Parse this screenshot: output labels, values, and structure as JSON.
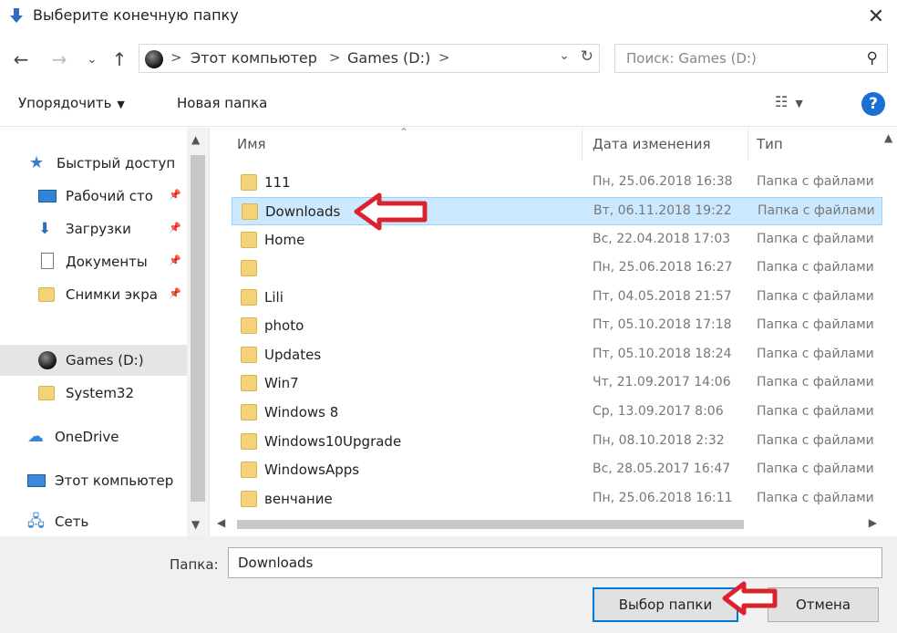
{
  "window": {
    "title": "Выберите конечную папку",
    "close_label": "✕"
  },
  "address": {
    "crumbs": [
      "Этот компьютер",
      "Games (D:)"
    ],
    "separator": ">"
  },
  "search": {
    "placeholder": "Поиск: Games (D:)"
  },
  "toolbar": {
    "organize_label": "Упорядочить",
    "new_folder_label": "Новая папка",
    "help_label": "?"
  },
  "sidebar": {
    "items": [
      {
        "label": "Быстрый доступ",
        "icon": "star-icon"
      },
      {
        "label": "Рабочий сто",
        "icon": "desktop-icon",
        "pinned": true
      },
      {
        "label": "Загрузки",
        "icon": "download-icon",
        "pinned": true
      },
      {
        "label": "Документы",
        "icon": "document-icon",
        "pinned": true
      },
      {
        "label": "Снимки экра",
        "icon": "folder-icon",
        "pinned": true
      },
      {
        "label": "Games (D:)",
        "icon": "disk-icon",
        "selected": true
      },
      {
        "label": "System32",
        "icon": "folder-icon"
      },
      {
        "label": "OneDrive",
        "icon": "cloud-icon"
      },
      {
        "label": "Этот компьютер",
        "icon": "computer-icon"
      },
      {
        "label": "Сеть",
        "icon": "network-icon"
      }
    ]
  },
  "list": {
    "columns": [
      "Имя",
      "Дата изменения",
      "Тип"
    ],
    "rows": [
      {
        "name": "111",
        "date": "Пн, 25.06.2018 16:38",
        "type": "Папка с файлами"
      },
      {
        "name": "Downloads",
        "date": "Вт, 06.11.2018 19:22",
        "type": "Папка с файлами",
        "selected": true
      },
      {
        "name": "Home",
        "date": "Вс, 22.04.2018 17:03",
        "type": "Папка с файлами"
      },
      {
        "name": "",
        "date": "Пн, 25.06.2018 16:27",
        "type": "Папка с файлами"
      },
      {
        "name": "Lili",
        "date": "Пт, 04.05.2018 21:57",
        "type": "Папка с файлами"
      },
      {
        "name": "photo",
        "date": "Пт, 05.10.2018 17:18",
        "type": "Папка с файлами"
      },
      {
        "name": "Updates",
        "date": "Пт, 05.10.2018 18:24",
        "type": "Папка с файлами"
      },
      {
        "name": "Win7",
        "date": "Чт, 21.09.2017 14:06",
        "type": "Папка с файлами"
      },
      {
        "name": "Windows 8",
        "date": "Ср, 13.09.2017 8:06",
        "type": "Папка с файлами"
      },
      {
        "name": "Windows10Upgrade",
        "date": "Пн, 08.10.2018 2:32",
        "type": "Папка с файлами"
      },
      {
        "name": "WindowsApps",
        "date": "Вс, 28.05.2017 16:47",
        "type": "Папка с файлами"
      },
      {
        "name": "венчание",
        "date": "Пн, 25.06.2018 16:11",
        "type": "Папка с файлами"
      }
    ]
  },
  "footer": {
    "folder_label": "Папка:",
    "folder_value": "Downloads",
    "select_button": "Выбор папки",
    "cancel_button": "Отмена"
  },
  "colors": {
    "accent": "#0078d7",
    "selection": "#cce8ff",
    "annotation_arrow": "#d9232d"
  }
}
